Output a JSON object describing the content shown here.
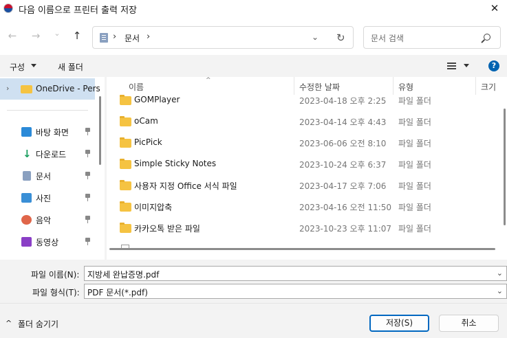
{
  "window": {
    "title": "다음 이름으로 프린터 출력 저장",
    "close_glyph": "✕"
  },
  "nav": {
    "back": "←",
    "forward": "→",
    "recent": "⌄",
    "up": "↑"
  },
  "address": {
    "separator": "›",
    "path": "문서",
    "dropdown": "⌄",
    "refresh": "↻"
  },
  "search": {
    "placeholder": "문서 검색"
  },
  "toolbar": {
    "organize": "구성",
    "new_folder": "새 폴더",
    "help": "?"
  },
  "sidebar": {
    "onedrive_chevron": "›",
    "onedrive": "OneDrive - Pers",
    "items": [
      {
        "label": "바탕 화면",
        "icon": "desktop-icon"
      },
      {
        "label": "다운로드",
        "icon": "download-icon"
      },
      {
        "label": "문서",
        "icon": "documents-icon"
      },
      {
        "label": "사진",
        "icon": "pictures-icon"
      },
      {
        "label": "음악",
        "icon": "music-icon"
      },
      {
        "label": "동영상",
        "icon": "videos-icon"
      }
    ]
  },
  "columns": {
    "sort_caret": "^",
    "name": "이름",
    "date": "수정한 날짜",
    "type": "유형",
    "size": "크기"
  },
  "files": [
    {
      "name": "GOMPlayer",
      "date": "2023-04-18 오후 2:25",
      "type": "파일 폴더"
    },
    {
      "name": "oCam",
      "date": "2023-04-14 오후 4:43",
      "type": "파일 폴더"
    },
    {
      "name": "PicPick",
      "date": "2023-06-06 오전 8:10",
      "type": "파일 폴더"
    },
    {
      "name": "Simple Sticky Notes",
      "date": "2023-10-24 오후 6:37",
      "type": "파일 폴더"
    },
    {
      "name": "사용자 지정 Office 서식 파일",
      "date": "2023-04-17 오후 7:06",
      "type": "파일 폴더"
    },
    {
      "name": "이미지압축",
      "date": "2023-04-16 오전 11:50",
      "type": "파일 폴더"
    },
    {
      "name": "카카오톡 받은 파일",
      "date": "2023-10-23 오후 11:07",
      "type": "파일 폴더"
    }
  ],
  "form": {
    "filename_label": "파일 이름(N):",
    "filename_value": "지방세 완납증명.pdf",
    "filetype_label": "파일 형식(T):",
    "filetype_value": "PDF 문서(*.pdf)",
    "dropdown": "⌄"
  },
  "footer": {
    "hide_chevron": "^",
    "hide_folders": "폴더 숨기기",
    "save": "저장(S)",
    "cancel": "취소"
  },
  "colors": {
    "accent": "#0067c0",
    "selection": "#cfe0f1",
    "folder": "#f5c342"
  }
}
